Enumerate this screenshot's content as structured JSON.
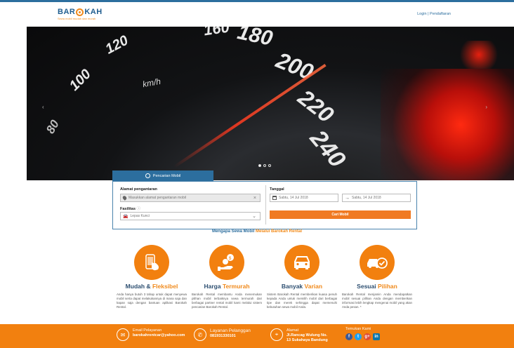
{
  "brand": {
    "name_left": "BAR",
    "name_right": "KAH",
    "tagline": "Sewa mobil mudah dan murah"
  },
  "header": {
    "login_link": "Login | Pendaftaran"
  },
  "hero": {
    "speedometer_labels": [
      "80",
      "100",
      "120",
      "160",
      "180",
      "200",
      "220",
      "240"
    ],
    "unit": "km/h",
    "prev_arrow": "‹",
    "next_arrow": "›",
    "slides_count": 3,
    "active_slide": 0
  },
  "search": {
    "tab_label": "Pencarian Mobil",
    "address_label": "Alamat pengantaran",
    "address_placeholder": "Masukkan alamat pengantaran mobil",
    "clear_symbol": "×",
    "facility_label": "Fasilitas",
    "facility_value": "Lepas Kunci",
    "date_label": "Tanggal",
    "date_from": "Sabtu, 14 Jul 2018",
    "date_to": "Sabtu, 14 Jul 2018",
    "submit_label": "Cari Mobil"
  },
  "why": {
    "prefix": "Mengapa Sewa Mobil",
    "highlight": "Melalui Barokah Rental"
  },
  "features": [
    {
      "title": "Mudah &",
      "title_hl": "Fleksibel",
      "desc": "Anda hanya butuh 3 tahap untuk dapat menyewa mobil serta dapat melakukannya di mana saja dan kapan saja dengan bantuan aplikasi Barokah Rental.",
      "icon": "phone-touch-icon"
    },
    {
      "title": "Harga",
      "title_hl": "Termurah",
      "desc": "Barokah Rental membantu Anda menemukan pilihan mobil terbaiknya sewa termurah dari berbagai partner rental mobil kami melalui sistem pencarian Barokah Rental.",
      "icon": "money-hand-icon"
    },
    {
      "title": "Banyak",
      "title_hl": "Varian",
      "desc": "Sistem Barokah Rental memberikan kuasa penuh kepada Anda untuk memilih mobil dari berbagai tipe dan merek sehingga dapat memenuhi kebutuhan sewa mobil Anda.",
      "icon": "car-front-icon"
    },
    {
      "title": "Sesuai",
      "title_hl": "Pilihan",
      "desc": "Barokah Rental menjamin Anda mendapatkan mobil sesuai pilihan Anda dengan memberikan informasi lebih lengkap mengenai mobil yang akan Anda pesan. *",
      "icon": "car-check-icon"
    }
  ],
  "footer": {
    "email_label": "Email Pelayanan",
    "email_value": "barokahrentcar@yahoo.com",
    "phone_label": "Layanan Pelanggan",
    "phone_value": "081931330101",
    "address_label": "Alamat",
    "address_line1": "Jl.Rancag Wulung No.",
    "address_line2": "13 Sukahaya Bandung",
    "social_label": "Temukan Kami",
    "social": [
      "f",
      "t",
      "g+",
      "in"
    ]
  },
  "colors": {
    "primary": "#2c6e9e",
    "accent": "#f2800f",
    "dark_title": "#2c4e70"
  }
}
